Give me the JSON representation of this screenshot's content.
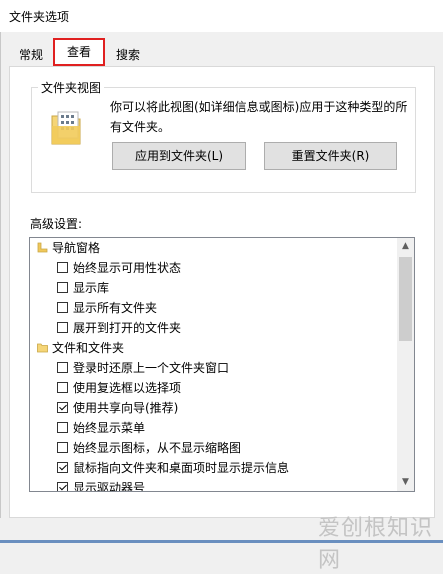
{
  "window": {
    "title": "文件夹选项"
  },
  "tabs": [
    {
      "label": "常规"
    },
    {
      "label": "查看"
    },
    {
      "label": "搜索"
    }
  ],
  "folder_views": {
    "title": "文件夹视图",
    "description": "你可以将此视图(如详细信息或图标)应用于这种类型的所有文件夹。",
    "apply_button": "应用到文件夹(L)",
    "reset_button": "重置文件夹(R)"
  },
  "advanced": {
    "label": "高级设置:",
    "items": [
      {
        "type": "section",
        "icon": "navigation-pane-icon",
        "label": "导航窗格"
      },
      {
        "type": "checkbox",
        "checked": false,
        "label": "始终显示可用性状态"
      },
      {
        "type": "checkbox",
        "checked": false,
        "label": "显示库"
      },
      {
        "type": "checkbox",
        "checked": false,
        "label": "显示所有文件夹"
      },
      {
        "type": "checkbox",
        "checked": false,
        "label": "展开到打开的文件夹"
      },
      {
        "type": "section",
        "icon": "folder-icon",
        "label": "文件和文件夹"
      },
      {
        "type": "checkbox",
        "checked": false,
        "label": "登录时还原上一个文件夹窗口"
      },
      {
        "type": "checkbox",
        "checked": false,
        "label": "使用复选框以选择项"
      },
      {
        "type": "checkbox",
        "checked": true,
        "label": "使用共享向导(推荐)"
      },
      {
        "type": "checkbox",
        "checked": false,
        "label": "始终显示菜单"
      },
      {
        "type": "checkbox",
        "checked": false,
        "label": "始终显示图标，从不显示缩略图"
      },
      {
        "type": "checkbox",
        "checked": true,
        "label": "鼠标指向文件夹和桌面项时显示提示信息"
      },
      {
        "type": "checkbox",
        "checked": true,
        "label": "显示驱动器号"
      }
    ]
  },
  "watermark": {
    "text": "爱创根知识网"
  },
  "colors": {
    "highlight": "#e02020",
    "folder": "#f5d577"
  }
}
